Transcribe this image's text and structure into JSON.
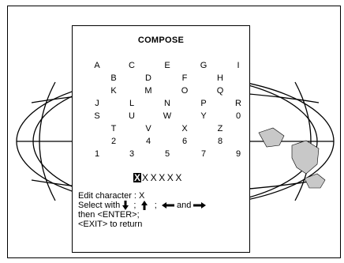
{
  "dialog": {
    "title": "COMPOSE",
    "characters": [
      "A",
      "B",
      "C",
      "D",
      "E",
      "F",
      "G",
      "H",
      "I",
      "J",
      "K",
      "L",
      "M",
      "N",
      "O",
      "P",
      "Q",
      "R",
      "S",
      "T",
      "U",
      "V",
      "W",
      "X",
      "Y",
      "Z",
      "0",
      "1",
      "2",
      "3",
      "4",
      "5",
      "6",
      "7",
      "8",
      "9"
    ],
    "edit_field": {
      "selected": "X",
      "rest": "XXXXX"
    },
    "help": {
      "edit_label": "Edit character :",
      "edit_value": "X",
      "select_prefix": "Select with",
      "and_text": "and",
      "then_text": "then <ENTER>;",
      "exit_text": "<EXIT> to return"
    }
  }
}
